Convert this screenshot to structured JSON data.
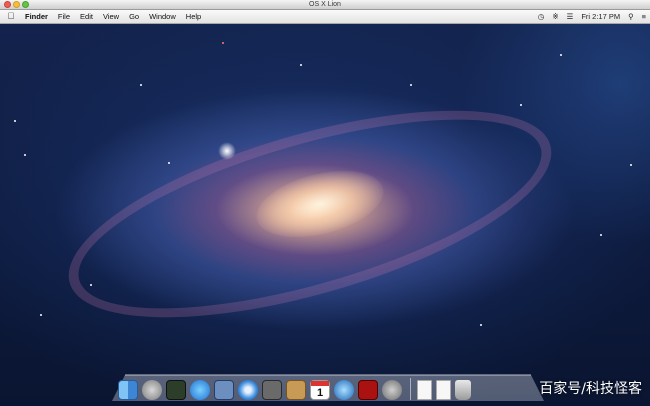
{
  "window": {
    "title": "OS X Lion"
  },
  "menubar": {
    "apple_icon": "apple-logo",
    "items": [
      "Finder",
      "File",
      "Edit",
      "View",
      "Go",
      "Window",
      "Help"
    ],
    "status": {
      "time_machine_icon": "clock-icon",
      "bluetooth_icon": "bluetooth-icon",
      "wifi_icon": "wifi-icon",
      "clock": "Fri 2:17 PM",
      "spotlight_icon": "search-icon",
      "notifications_icon": "list-icon"
    }
  },
  "dock": {
    "apps": [
      "finder",
      "launchpad",
      "mission-control",
      "app-store",
      "preview",
      "safari",
      "facetime",
      "contacts",
      "calendar",
      "itunes",
      "photo-booth",
      "system-preferences"
    ],
    "calendar_day": "1"
  },
  "watermark": "百家号/科技怪客",
  "colors": {
    "menubar": "#e8e8e8",
    "desktop": "#13234d",
    "close": "#ee5c52",
    "minimize": "#f6be3b",
    "zoom": "#65c447"
  }
}
